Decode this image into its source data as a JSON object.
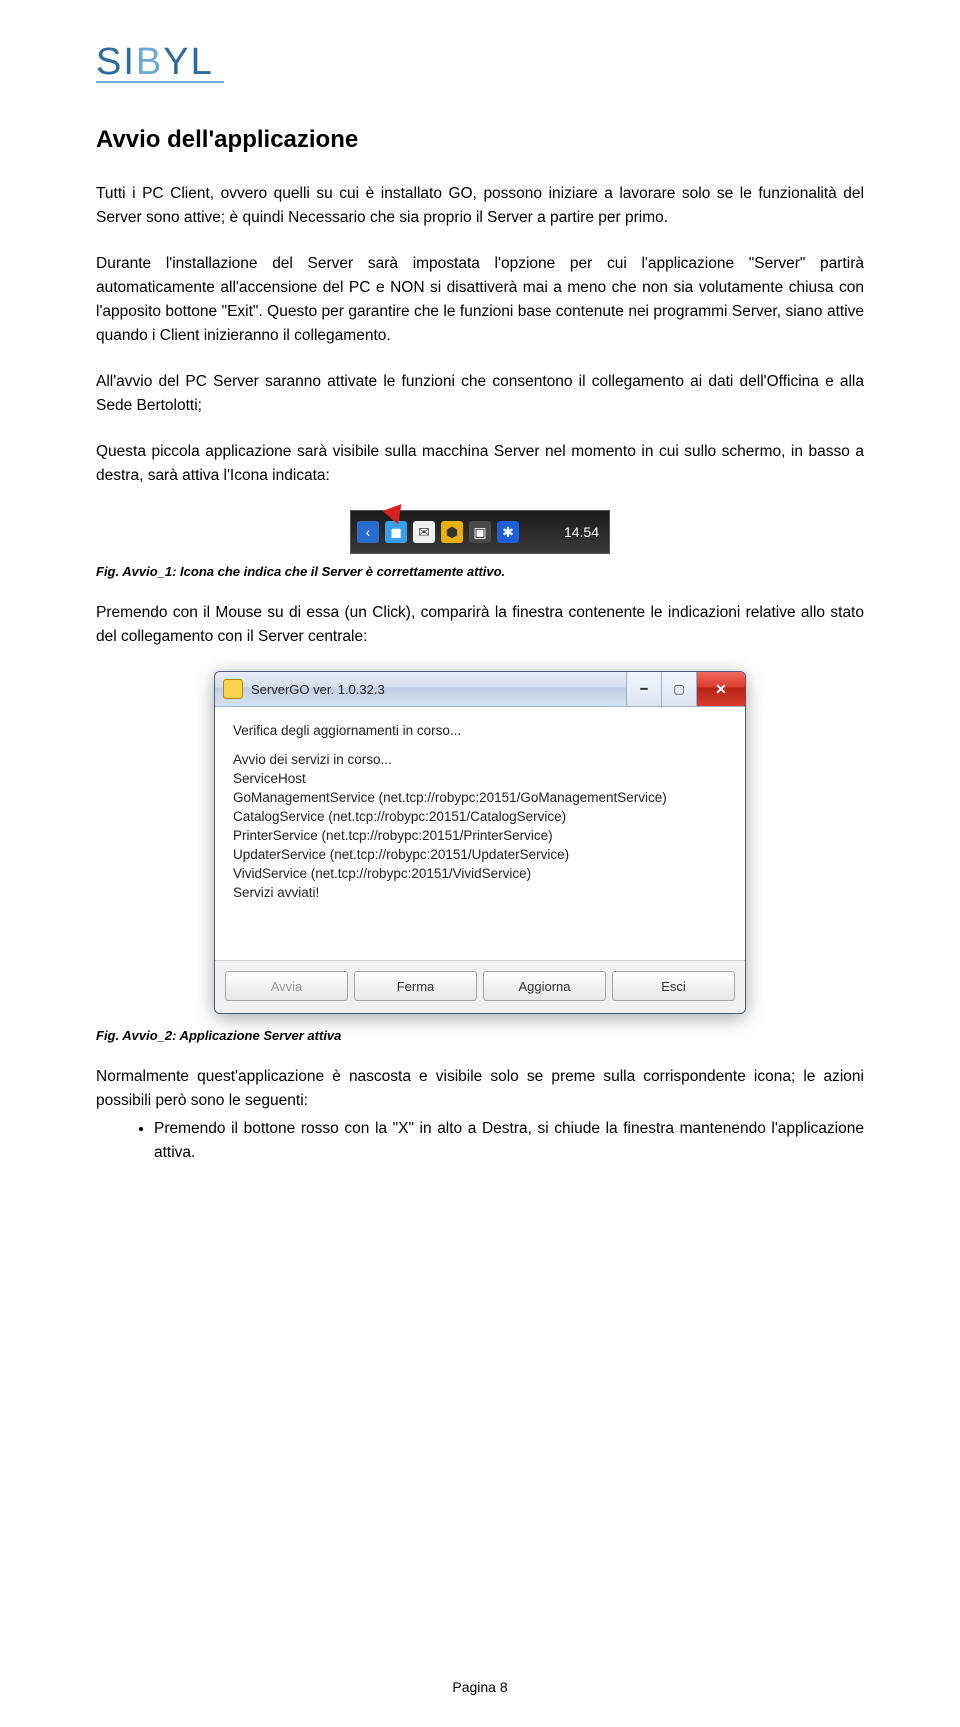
{
  "logo_text": "SIBYL",
  "title": "Avvio dell'applicazione",
  "paragraphs": {
    "p1": "Tutti i PC Client, ovvero quelli su cui è installato GO, possono iniziare a lavorare solo se le funzionalità del Server sono attive; è quindi Necessario che sia proprio il Server a partire per primo.",
    "p2": "Durante l'installazione del Server sarà impostata l'opzione per cui l'applicazione \"Server\" partirà automaticamente all'accensione del PC e NON si disattiverà mai a meno che non sia volutamente chiusa con l'apposito bottone \"Exit\". Questo per garantire che le funzioni base contenute nei programmi Server, siano attive quando i Client inizieranno il collegamento.",
    "p3": "All'avvio del PC Server saranno attivate le funzioni che consentono il collegamento ai dati dell'Officina e alla Sede Bertolotti;",
    "p4": "Questa piccola applicazione sarà visibile sulla macchina Server nel momento in cui sullo schermo, in basso a destra, sarà attiva l'Icona indicata:",
    "p5": "Premendo con il Mouse su di essa (un Click), comparirà la finestra contenente le indicazioni relative allo stato del collegamento con il Server centrale:",
    "p6": "Normalmente quest'applicazione è nascosta e visibile solo se preme sulla corrispondente icona; le azioni possibili però sono le seguenti:"
  },
  "tray": {
    "clock": "14.54"
  },
  "captions": {
    "c1": "Fig. Avvio_1: Icona che indica che il Server è correttamente attivo.",
    "c2": "Fig. Avvio_2: Applicazione Server attiva"
  },
  "dialog": {
    "title": "ServerGO ver. 1.0.32.3",
    "lines": [
      "Verifica degli aggiornamenti in corso...",
      "",
      "Avvio dei servizi in corso...",
      "ServiceHost",
      "GoManagementService (net.tcp://robypc:20151/GoManagementService)",
      "CatalogService (net.tcp://robypc:20151/CatalogService)",
      "PrinterService (net.tcp://robypc:20151/PrinterService)",
      "UpdaterService (net.tcp://robypc:20151/UpdaterService)",
      "VividService (net.tcp://robypc:20151/VividService)",
      "Servizi avviati!"
    ],
    "buttons": {
      "avvia": "Avvia",
      "ferma": "Ferma",
      "aggiorna": "Aggiorna",
      "esci": "Esci"
    }
  },
  "bullets": [
    "Premendo il bottone rosso con la \"X\" in alto a Destra, si chiude la finestra mantenendo l'applicazione attiva."
  ],
  "footer": "Pagina 8"
}
